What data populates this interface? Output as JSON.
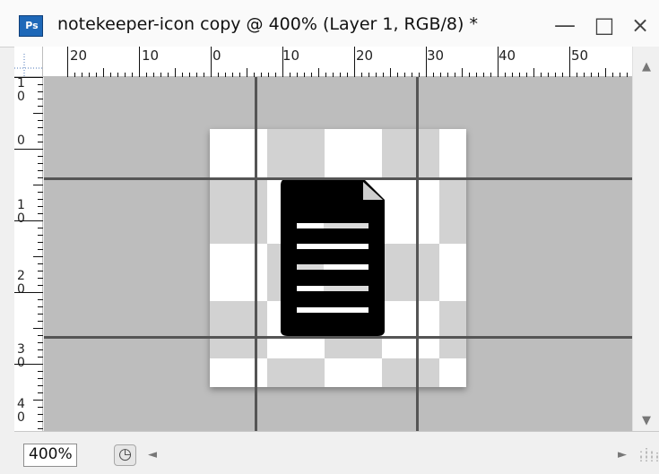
{
  "window": {
    "app_badge": "Ps",
    "document_title": "notekeeper-icon copy @ 400% (Layer 1, RGB/8) *",
    "minimize_symbol": "—",
    "maximize_symbol": "□",
    "close_symbol": "×"
  },
  "rulers": {
    "horizontal_labels": [
      "20",
      "10",
      "0",
      "10",
      "20",
      "30",
      "40",
      "50"
    ],
    "vertical_labels": [
      "1\n0",
      "0",
      "1\n0",
      "2\n0",
      "3\n0",
      "4\n0"
    ]
  },
  "canvas": {
    "background_color": "#bdbdbd",
    "document_checker_light": "#ffffff",
    "document_checker_dark": "#d2d2d2",
    "guide_color": "#555555",
    "icon_color": "#000000"
  },
  "statusbar": {
    "zoom_value": "400%",
    "proof_icon": "◷",
    "left_arrow": "◄",
    "right_arrow": "►"
  },
  "scrollbars": {
    "up_arrow": "▲",
    "down_arrow": "▼"
  }
}
